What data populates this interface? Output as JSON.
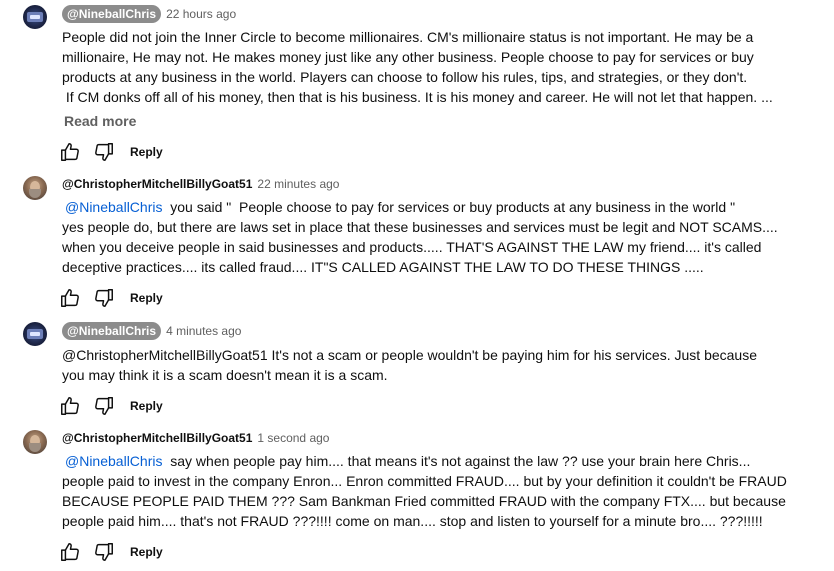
{
  "comments": [
    {
      "author": "@NineballChris",
      "timestamp": "22 hours ago",
      "avatar": "channel-logo",
      "lines": [
        "People did not join the Inner Circle to become millionaires. CM's millionaire status is not important. He may be a",
        "millionaire, He may not. He makes money just like any other business. People choose to pay for services or buy",
        "products at any business in the world. Players can choose to follow his rules, tips, and strategies, or they don't.",
        " If CM donks off all of his money, then that is his business. It is his money and career. He will not let that happen. ..."
      ],
      "read_more": "Read more",
      "reply_label": "Reply"
    },
    {
      "author": "@ChristopherMitchellBillyGoat51",
      "timestamp": "22 minutes ago",
      "avatar": "user-photo",
      "mention": "@NineballChris",
      "first_line_rest": "  you said \"  People choose to pay for services or buy products at any business in the world \"",
      "lines": [
        "yes people do, but there are laws set in place that these businesses and services must be legit and NOT SCAMS....",
        "when you deceive people in said businesses and products..... THAT'S AGAINST THE LAW my friend.... it's called",
        "deceptive practices.... its called fraud.... IT\"S CALLED AGAINST THE LAW TO DO THESE THINGS ....."
      ],
      "reply_label": "Reply"
    },
    {
      "author": "@NineballChris",
      "timestamp": "4 minutes ago",
      "avatar": "channel-logo",
      "lines": [
        "@ChristopherMitchellBillyGoat51 It's not a scam or people wouldn't be paying him for his services. Just because",
        "you may think it is a scam doesn't mean it is a scam."
      ],
      "reply_label": "Reply"
    },
    {
      "author": "@ChristopherMitchellBillyGoat51",
      "timestamp": "1 second ago",
      "avatar": "user-photo",
      "mention": "@NineballChris",
      "first_line_rest": "  say when people pay him.... that means it's not against the law ?? use your brain here Chris...",
      "lines": [
        "people paid to invest in the company Enron... Enron committed FRAUD.... but by your definition it couldn't be FRAUD",
        "BECAUSE PEOPLE PAID THEM ??? Sam Bankman Fried committed FRAUD with the company FTX.... but because",
        "people paid him.... that's not FRAUD ???!!!! come on man.... stop and listen to yourself for a minute bro.... ???!!!!!"
      ],
      "reply_label": "Reply"
    }
  ],
  "icons": {
    "like": "thumbs-up-icon",
    "dislike": "thumbs-down-icon"
  },
  "colors": {
    "mention": "#065fd4",
    "author_chip_bg": "#8c8c8c",
    "timestamp": "#606060"
  }
}
